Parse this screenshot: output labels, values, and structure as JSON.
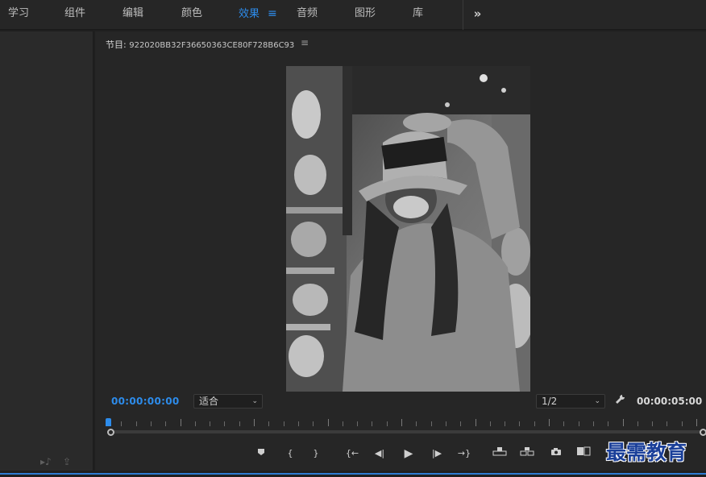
{
  "workspaces": {
    "tabs": [
      {
        "label": "学习",
        "active": false
      },
      {
        "label": "组件",
        "active": false
      },
      {
        "label": "编辑",
        "active": false
      },
      {
        "label": "颜色",
        "active": false
      },
      {
        "label": "效果",
        "active": true
      },
      {
        "label": "音频",
        "active": false
      },
      {
        "label": "图形",
        "active": false
      },
      {
        "label": "库",
        "active": false
      }
    ],
    "active_menu_icon": "≡",
    "more_icon": "»"
  },
  "monitor": {
    "title_prefix": "节目:",
    "sequence_name": "922020BB32F36650363CE80F728B6C93",
    "panel_menu_icon": "≡",
    "current_timecode": "00:00:00:00",
    "zoom_select": "适合",
    "resolution_select": "1/2",
    "duration_timecode": "00:00:05:00",
    "settings_icon": "wrench-icon"
  },
  "transport": {
    "add_marker": "⬟",
    "mark_in": "{",
    "mark_out": "}",
    "go_to_in": "{←",
    "step_back": "◀|",
    "play": "▶",
    "step_forward": "|▶",
    "go_to_out": "→}",
    "lift": "⊓",
    "extract": "⊓",
    "export_frame": "📷",
    "compare": "▣"
  },
  "left_panel": {
    "icon_a": "▸♪",
    "icon_b": "⇪"
  },
  "watermark": "最需教育",
  "colors": {
    "accent": "#2d8ceb",
    "panel": "#262626",
    "background": "#1f1f1f",
    "watermark": "#1a3f99"
  }
}
